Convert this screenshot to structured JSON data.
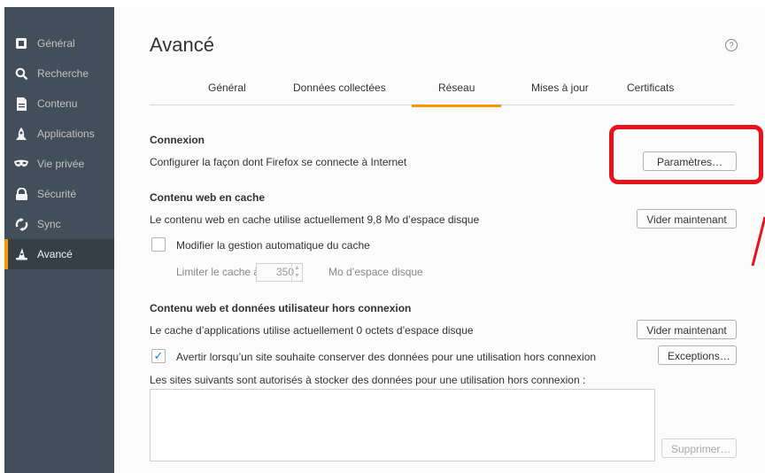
{
  "sidebar": {
    "items": [
      {
        "label": "Général",
        "icon": "general-icon",
        "active": false
      },
      {
        "label": "Recherche",
        "icon": "search-icon",
        "active": false
      },
      {
        "label": "Contenu",
        "icon": "document-icon",
        "active": false
      },
      {
        "label": "Applications",
        "icon": "rocket-icon",
        "active": false
      },
      {
        "label": "Vie privée",
        "icon": "mask-icon",
        "active": false
      },
      {
        "label": "Sécurité",
        "icon": "lock-icon",
        "active": false
      },
      {
        "label": "Sync",
        "icon": "sync-icon",
        "active": false
      },
      {
        "label": "Avancé",
        "icon": "wizard-hat-icon",
        "active": true
      }
    ]
  },
  "page": {
    "title": "Avancé",
    "help": "?"
  },
  "tabs": [
    {
      "label": "Général"
    },
    {
      "label": "Données collectées"
    },
    {
      "label": "Réseau",
      "selected": true
    },
    {
      "label": "Mises à jour"
    },
    {
      "label": "Certificats"
    }
  ],
  "connexion": {
    "heading": "Connexion",
    "desc": "Configurer la façon dont Firefox se connecte à Internet",
    "button": "Paramètres…"
  },
  "cache": {
    "heading": "Contenu web en cache",
    "desc": "Le contenu web en cache utilise actuellement 9,8 Mo d’espace disque",
    "button": "Vider maintenant",
    "override_label": "Modifier la gestion automatique du cache",
    "override_checked": false,
    "limit_prefix": "Limiter le cache à",
    "limit_value": "350",
    "limit_suffix": "Mo d’espace disque"
  },
  "offline": {
    "heading": "Contenu web et données utilisateur hors connexion",
    "desc": "Le cache d’applications utilise actuellement 0 octets d’espace disque",
    "button": "Vider maintenant",
    "warn_label": "Avertir lorsqu’un site souhaite conserver des données pour une utilisation hors connexion",
    "warn_checked": true,
    "exceptions_button": "Exceptions…",
    "list_label": "Les sites suivants sont autorisés à stocker des données pour une utilisation hors connexion :",
    "remove_button": "Supprimer…",
    "check_mark": "✓"
  },
  "colors": {
    "accent": "#ff9500",
    "highlight": "#e8141c",
    "sidebar": "#424f5a"
  }
}
